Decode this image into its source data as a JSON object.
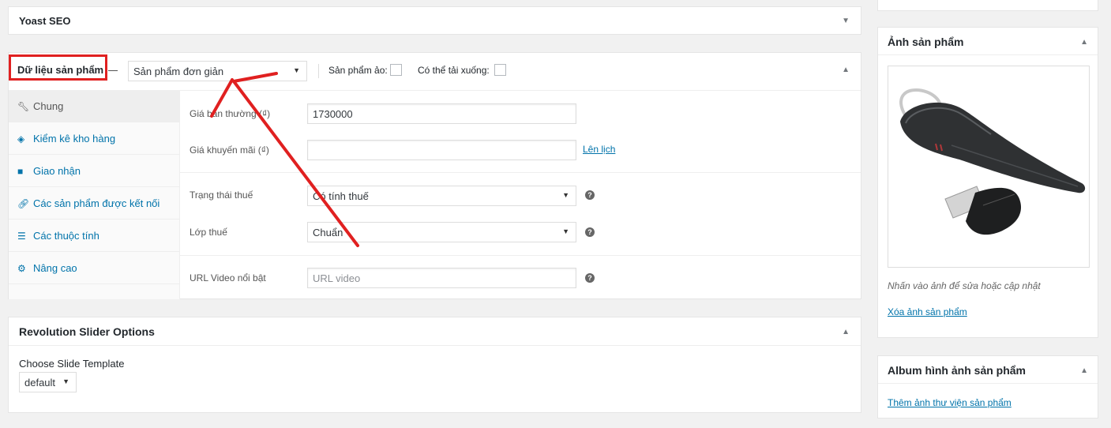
{
  "yoast": {
    "title": "Yoast SEO"
  },
  "product_data": {
    "title": "Dữ liệu sản phẩm",
    "type_select": "Sản phẩm đơn giản",
    "virtual_label": "Sản phẩm ảo:",
    "downloadable_label": "Có thể tải xuống:",
    "tabs": [
      {
        "label": "Chung",
        "icon": "wrench-icon"
      },
      {
        "label": "Kiểm kê kho hàng",
        "icon": "tag-icon"
      },
      {
        "label": "Giao nhận",
        "icon": "truck-icon"
      },
      {
        "label": "Các sản phẩm được kết nối",
        "icon": "link-icon"
      },
      {
        "label": "Các thuộc tính",
        "icon": "list-icon"
      },
      {
        "label": "Nâng cao",
        "icon": "gear-icon"
      }
    ],
    "fields": {
      "regular_price_label": "Giá bán thường (₫)",
      "regular_price_value": "1730000",
      "sale_price_label": "Giá khuyến mãi (₫)",
      "sale_price_value": "",
      "schedule_link": "Lên lịch",
      "tax_status_label": "Trạng thái thuế",
      "tax_status_value": "Có tính thuế",
      "tax_class_label": "Lớp thuế",
      "tax_class_value": "Chuẩn",
      "video_label": "URL Video nổi bật",
      "video_placeholder": "URL video"
    }
  },
  "revslider": {
    "title": "Revolution Slider Options",
    "template_label": "Choose Slide Template",
    "template_value": "default"
  },
  "product_image": {
    "title": "Ảnh sản phẩm",
    "hint": "Nhấn vào ảnh để sửa hoặc cập nhật",
    "remove_link": "Xóa ảnh sản phẩm"
  },
  "gallery": {
    "title": "Album hình ảnh sản phẩm",
    "add_link": "Thêm ảnh thư viện sản phẩm"
  },
  "colors": {
    "link": "#0073aa",
    "annotation_red": "#e02020",
    "border": "#e5e5e5"
  }
}
